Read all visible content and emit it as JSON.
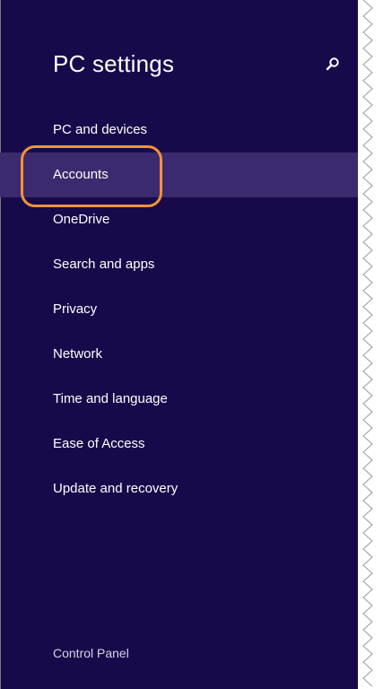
{
  "window": {
    "title": "PC settings"
  },
  "search": {
    "icon": "search-icon"
  },
  "nav": {
    "selected_index": 1,
    "items": [
      {
        "label": "PC and devices"
      },
      {
        "label": "Accounts"
      },
      {
        "label": "OneDrive"
      },
      {
        "label": "Search and apps"
      },
      {
        "label": "Privacy"
      },
      {
        "label": "Network"
      },
      {
        "label": "Time and language"
      },
      {
        "label": "Ease of Access"
      },
      {
        "label": "Update and recovery"
      }
    ]
  },
  "footer": {
    "control_panel_label": "Control Panel"
  },
  "colors": {
    "pane_background": "#180a4a",
    "selected_item_background": "#3b2a6e",
    "highlight_ring": "#f2923a",
    "text": "#ffffff"
  }
}
